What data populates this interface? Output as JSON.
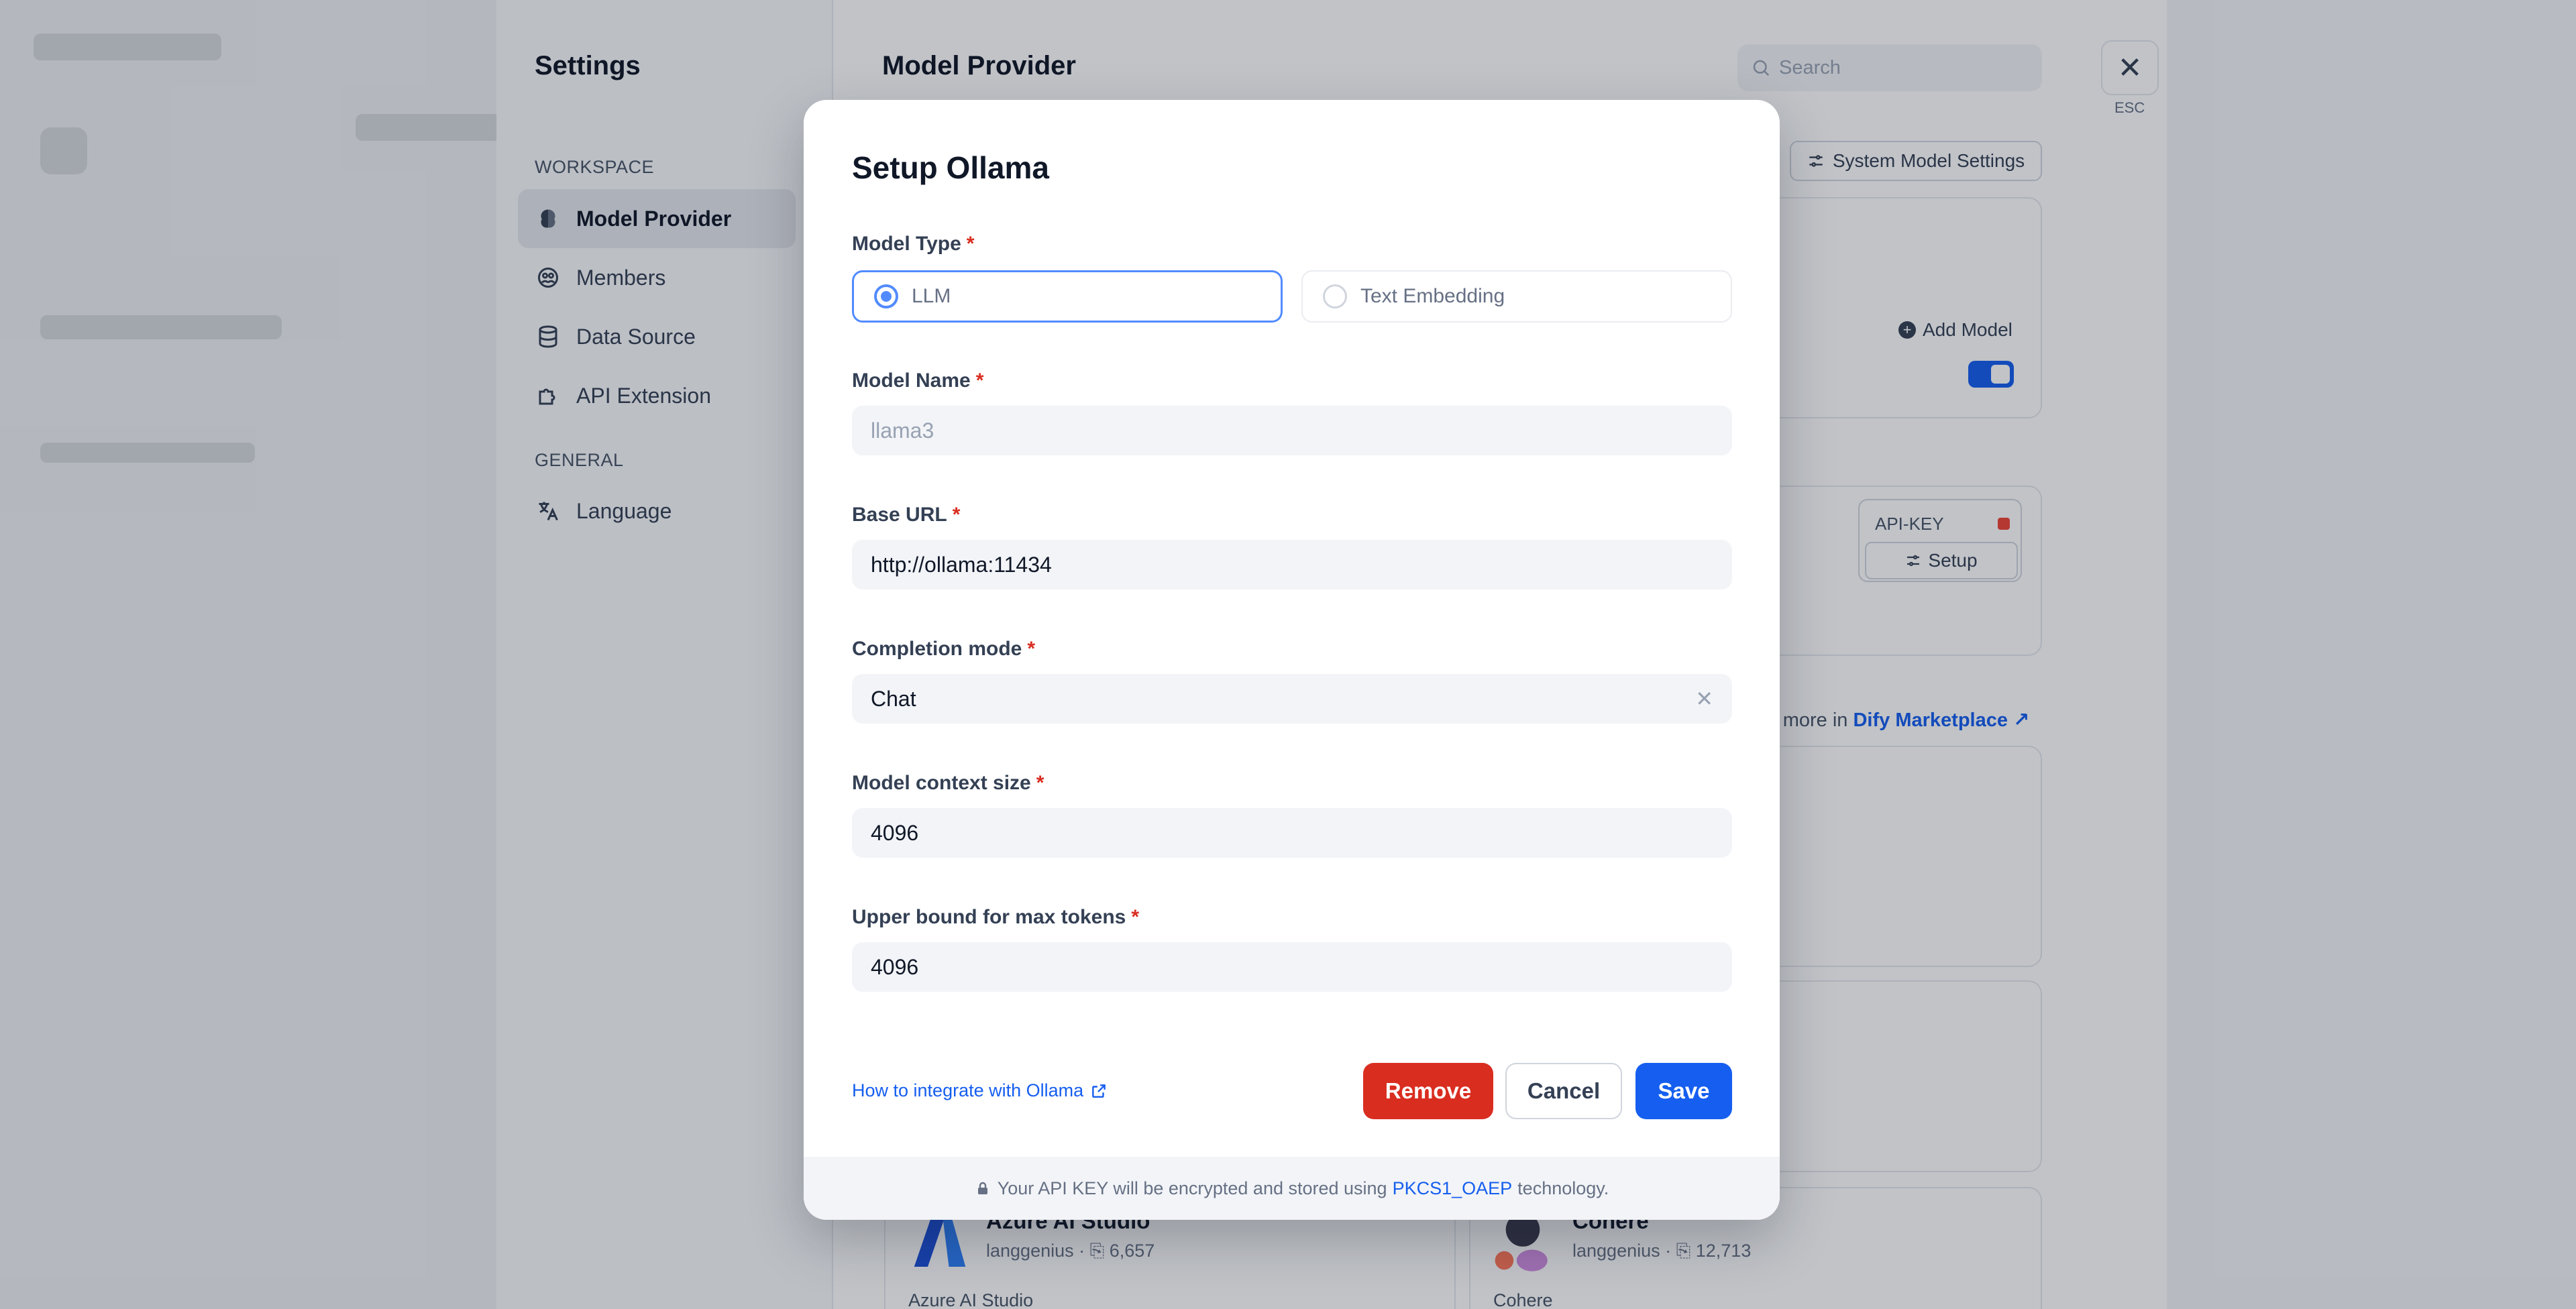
{
  "settings": {
    "title": "Settings",
    "sections": {
      "workspace": "WORKSPACE",
      "general": "GENERAL"
    },
    "nav": {
      "model_provider": "Model Provider",
      "members": "Members",
      "data_source": "Data Source",
      "api_extension": "API Extension",
      "language": "Language"
    }
  },
  "main": {
    "title": "Model Provider",
    "search_placeholder": "Search",
    "esc_label": "ESC",
    "system_model_settings": "System Model Settings",
    "add_model": "Add Model",
    "api_key_label": "API-KEY",
    "setup_label": "Setup",
    "marketplace_prefix": "r more in",
    "marketplace_link": "Dify Marketplace",
    "providers": [
      {
        "name": "Azure AI Studio",
        "author": "langgenius",
        "installs": "6,657",
        "desc": "Azure AI Studio"
      },
      {
        "name": "Cohere",
        "author": "langgenius",
        "installs": "12,713",
        "desc": "Cohere"
      }
    ]
  },
  "modal": {
    "title": "Setup Ollama",
    "model_type": {
      "label": "Model Type",
      "options": [
        "LLM",
        "Text Embedding"
      ],
      "selected": "LLM"
    },
    "model_name": {
      "label": "Model Name",
      "placeholder": "llama3"
    },
    "base_url": {
      "label": "Base URL",
      "value": "http://ollama:11434"
    },
    "completion_mode": {
      "label": "Completion mode",
      "value": "Chat"
    },
    "context_size": {
      "label": "Model context size",
      "value": "4096"
    },
    "max_tokens": {
      "label": "Upper bound for max tokens",
      "value": "4096"
    },
    "required_mark": "*",
    "help_link": "How to integrate with Ollama",
    "buttons": {
      "remove": "Remove",
      "cancel": "Cancel",
      "save": "Save"
    },
    "footer": {
      "prefix": "Your API KEY will be encrypted and stored using",
      "keyword": "PKCS1_OAEP",
      "suffix": "technology."
    }
  },
  "colors": {
    "primary": "#155eef",
    "danger": "#d92d20",
    "radio_accent": "#528bff"
  }
}
